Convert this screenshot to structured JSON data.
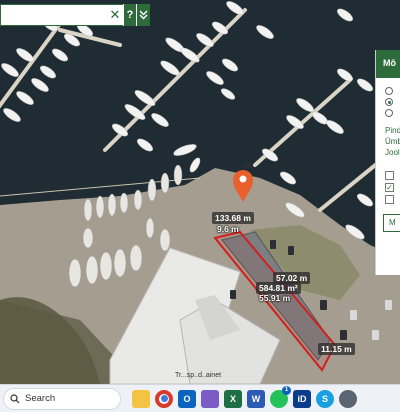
{
  "search": {
    "value": "",
    "placeholder": "",
    "clear_icon": "close-icon",
    "help_label": "?",
    "expand_icon": "chevron-double-down-icon"
  },
  "map": {
    "credit": "Tr...sp..d..ainet",
    "measurements": {
      "perimeter": "133.68 m",
      "side_top": "9.6 m",
      "side_right": "57.02 m",
      "area": "584.81 m²",
      "side_left": "55.91 m",
      "side_bottom": "11.15 m"
    },
    "polygon_color": "#d21f1f",
    "marker_color": "#e8612c"
  },
  "panel": {
    "title": "Mõ",
    "radios": [
      {
        "selected": false
      },
      {
        "selected": true
      },
      {
        "selected": false
      }
    ],
    "texts": [
      "Pind",
      "Ümb",
      "Jool"
    ],
    "checkboxes": [
      {
        "checked": false
      },
      {
        "checked": true
      },
      {
        "checked": false
      }
    ],
    "button_label": "M"
  },
  "taskbar": {
    "search_label": "Search",
    "apps": [
      {
        "name": "file-explorer-icon",
        "label": "",
        "color": "#f5c343"
      },
      {
        "name": "chrome-icon",
        "label": "",
        "color": "#ffffff"
      },
      {
        "name": "outlook-icon",
        "label": "O",
        "color": "#0a64c0"
      },
      {
        "name": "app-grid-icon",
        "label": "",
        "color": "#7a5cc4"
      },
      {
        "name": "excel-icon",
        "label": "X",
        "color": "#1d7044"
      },
      {
        "name": "word-icon",
        "label": "W",
        "color": "#2b5bb5"
      },
      {
        "name": "whatsapp-icon",
        "label": "",
        "color": "#25c15a",
        "badge": "1"
      },
      {
        "name": "id-card-icon",
        "label": "iD",
        "color": "#0a3c8c"
      },
      {
        "name": "skype-icon",
        "label": "S",
        "color": "#1aa0e0"
      },
      {
        "name": "app-round-icon",
        "label": "",
        "color": "#5a6472"
      }
    ]
  }
}
